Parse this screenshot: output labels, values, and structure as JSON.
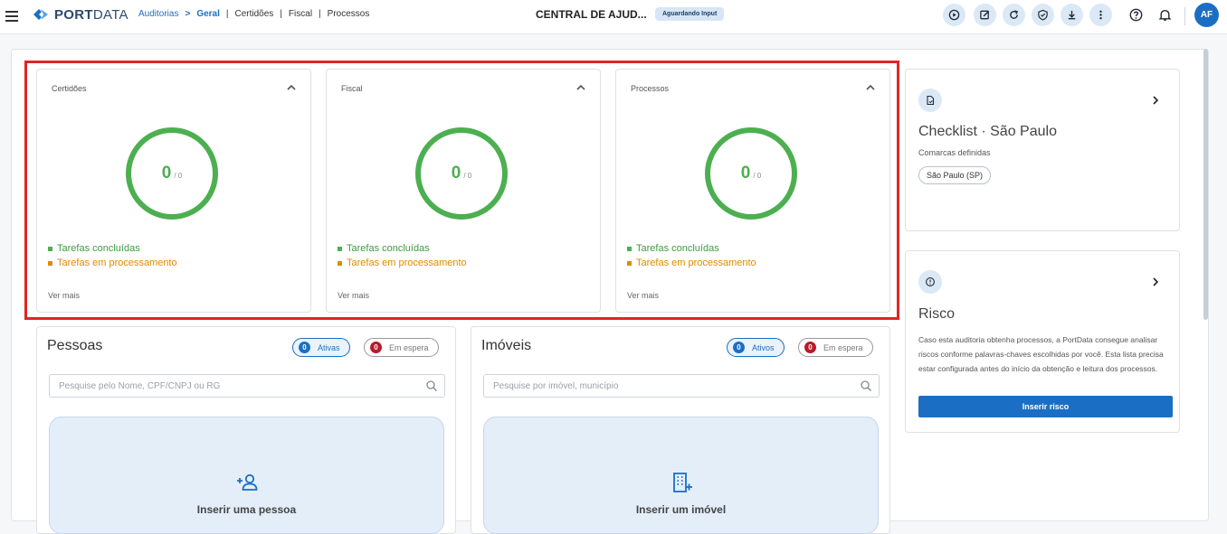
{
  "header": {
    "logo_text_bold": "PORT",
    "logo_text_rest": "DATA",
    "breadcrumb": {
      "root": "Auditorias",
      "arrow": ">",
      "active": "Geral",
      "items": [
        "Certidões",
        "Fiscal",
        "Processos"
      ],
      "separator": "|"
    },
    "central_label": "CENTRAL DE AJUD...",
    "status_badge": "Aguardando Input",
    "toolbar_icons": [
      "play-circle-icon",
      "edit-icon",
      "refresh-icon",
      "shield-check-icon",
      "download-icon",
      "more-vertical-icon"
    ],
    "help_icon": "help-circle-icon",
    "bell_icon": "bell-icon",
    "avatar_initials": "AF"
  },
  "status_cards": [
    {
      "title": "Certidões",
      "done": "0",
      "total": "/ 0",
      "legend_done": "Tarefas concluídas",
      "legend_processing": "Tarefas em processamento",
      "more": "Ver mais"
    },
    {
      "title": "Fiscal",
      "done": "0",
      "total": "/ 0",
      "legend_done": "Tarefas concluídas",
      "legend_processing": "Tarefas em processamento",
      "more": "Ver mais"
    },
    {
      "title": "Processos",
      "done": "0",
      "total": "/ 0",
      "legend_done": "Tarefas concluídas",
      "legend_processing": "Tarefas em processamento",
      "more": "Ver mais"
    }
  ],
  "checklist": {
    "title": "Checklist · São Paulo",
    "subtitle": "Comarcas definidas",
    "chips": [
      "São Paulo (SP)"
    ]
  },
  "risco": {
    "title": "Risco",
    "description": "Caso esta auditoria obtenha processos, a PortData consegue analisar riscos conforme palavras-chaves escolhidas por você. Esta lista precisa estar configurada antes do início da obtenção e leitura dos processos.",
    "button": "Inserir risco"
  },
  "pessoas": {
    "title": "Pessoas",
    "active_count": "0",
    "active_label": "Ativas",
    "waiting_count": "0",
    "waiting_label": "Em espera",
    "search_placeholder": "Pesquise pelo Nome, CPF/CNPJ ou RG",
    "add_label": "Inserir uma pessoa"
  },
  "imoveis": {
    "title": "Imóveis",
    "active_count": "0",
    "active_label": "Ativos",
    "waiting_count": "0",
    "waiting_label": "Em espera",
    "search_placeholder": "Pesquise por imóvel, município",
    "add_label": "Inserir um imóvel"
  },
  "colors": {
    "accent": "#1a6fc4",
    "done": "#4caf50",
    "processing": "#e08a00",
    "highlight": "#e02424",
    "waiting_badge": "#b71c2b"
  }
}
